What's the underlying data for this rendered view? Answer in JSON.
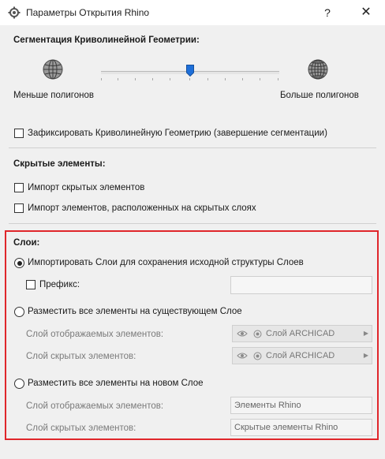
{
  "window": {
    "title": "Параметры Открытия Rhino",
    "help_label": "?",
    "close_label": "✕"
  },
  "segmentation": {
    "heading": "Сегментация Криволинейной Геометрии:",
    "less_label": "Меньше полигонов",
    "more_label": "Больше полигонов",
    "slider_fraction": 0.5
  },
  "fix_geometry": {
    "label": "Зафиксировать Криволинейную Геометрию (завершение сегментации)",
    "checked": false
  },
  "hidden_elements": {
    "heading": "Скрытые элементы:",
    "import_hidden_label": "Импорт скрытых элементов",
    "import_hidden_layers_label": "Импорт элементов, расположенных на скрытых слоях"
  },
  "layers": {
    "heading": "Слои:",
    "option_import": "Импортировать Слои для сохранения исходной структуры Слоев",
    "prefix_label": "Префикс:",
    "prefix_value": "",
    "option_existing": "Разместить все элементы на существующем Слое",
    "existing_visible_label": "Слой отображаемых элементов:",
    "existing_visible_value": "Слой ARCHICAD",
    "existing_hidden_label": "Слой скрытых элементов:",
    "existing_hidden_value": "Слой ARCHICAD",
    "option_new": "Разместить все элементы на новом Слое",
    "new_visible_label": "Слой отображаемых элементов:",
    "new_visible_value": "Элементы Rhino",
    "new_hidden_label": "Слой скрытых элементов:",
    "new_hidden_value": "Скрытые элементы Rhino"
  },
  "colors": {
    "highlight_border": "#e0262b",
    "slider_thumb": "#1e6fd9"
  }
}
